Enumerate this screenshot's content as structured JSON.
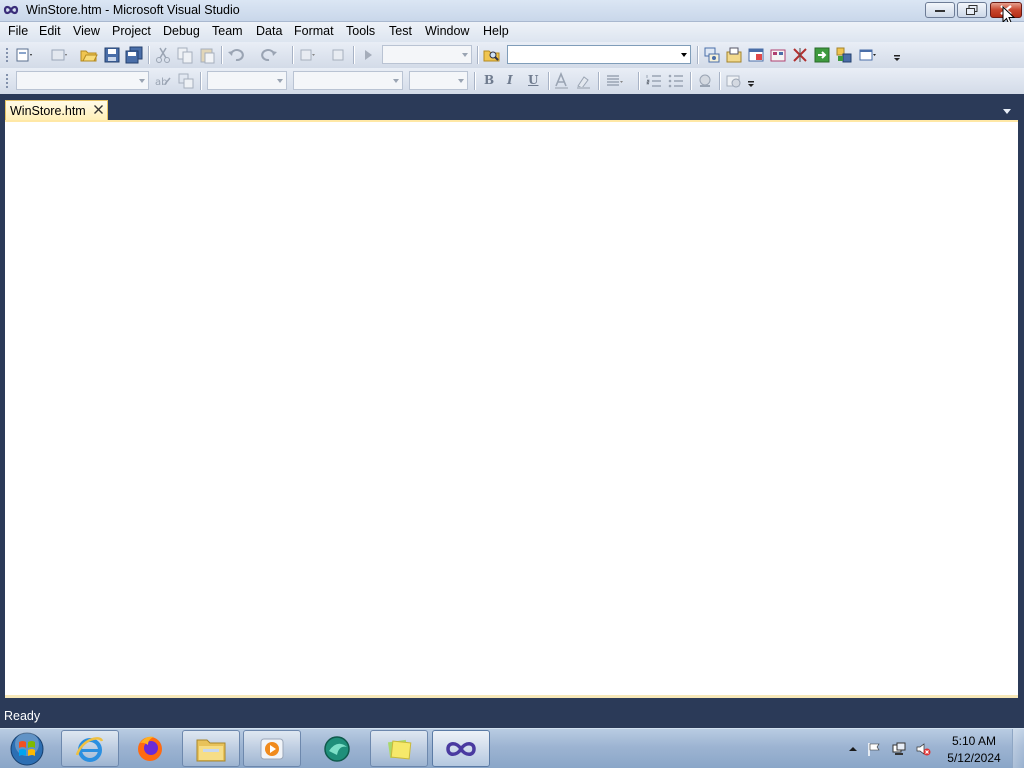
{
  "window": {
    "title": "WinStore.htm - Microsoft Visual Studio",
    "app_icon": "visual-studio-infinity-icon",
    "controls": [
      "minimize-icon",
      "restore-icon",
      "close-icon"
    ]
  },
  "menu": {
    "items": [
      "File",
      "Edit",
      "View",
      "Project",
      "Debug",
      "Team",
      "Data",
      "Format",
      "Tools",
      "Test",
      "Window",
      "Help"
    ]
  },
  "toolbar_standard": {
    "icons": [
      "new-project-icon",
      "add-item-icon",
      "open-file-icon",
      "save-icon",
      "save-all-icon",
      "cut-icon",
      "copy-icon",
      "paste-icon",
      "undo-icon",
      "redo-icon",
      "navigate-backward-icon",
      "navigate-forward-icon",
      "start-debugging-icon",
      "find-in-files-icon",
      "solution-explorer-icon",
      "properties-icon",
      "object-browser-icon",
      "toolbox-icon",
      "start-page-icon",
      "extension-manager-icon",
      "command-window-icon"
    ],
    "find_box_value": ""
  },
  "toolbar_formatting": {
    "bold": "B",
    "italic": "I",
    "underline": "U",
    "icons": [
      "style-application-icon",
      "target-rule-icon",
      "font-color-icon",
      "highlight-icon",
      "justify-icon",
      "numbered-list-icon",
      "bulleted-list-icon",
      "hyperlink-icon",
      "toggle-design-icon"
    ]
  },
  "document_tabs": [
    {
      "label": "WinStore.htm",
      "active": true
    }
  ],
  "status": {
    "text": "Ready"
  },
  "taskbar": {
    "start_icon": "windows-start-orb-icon",
    "items": [
      {
        "name": "internet-explorer-icon",
        "state": "open"
      },
      {
        "name": "firefox-icon",
        "state": "pinned"
      },
      {
        "name": "windows-explorer-icon",
        "state": "open"
      },
      {
        "name": "media-player-icon",
        "state": "open"
      },
      {
        "name": "teal-app-icon",
        "state": "pinned"
      },
      {
        "name": "sticky-notes-icon",
        "state": "open"
      },
      {
        "name": "visual-studio-icon",
        "state": "active"
      }
    ],
    "tray_icons": [
      "show-hidden-icons-arrow",
      "action-center-flag-icon",
      "network-icon",
      "volume-muted-icon"
    ],
    "clock": {
      "time": "5:10 AM",
      "date": "5/12/2024"
    }
  }
}
